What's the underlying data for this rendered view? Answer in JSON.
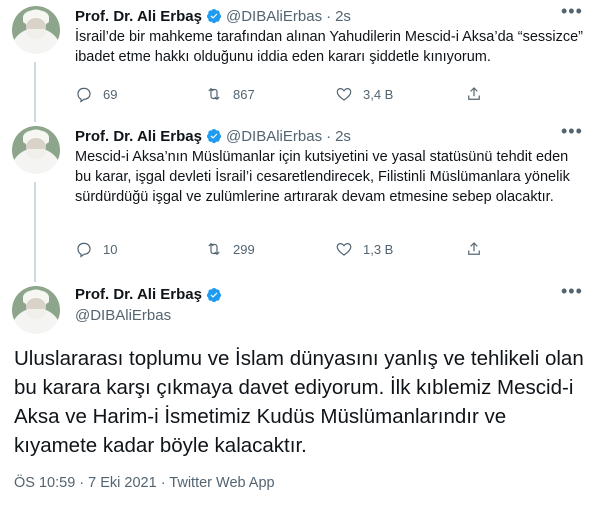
{
  "tweets": [
    {
      "name": "Prof. Dr. Ali Erbaş",
      "handle": "@DIBAliErbas",
      "separator": "·",
      "time": "2s",
      "text": "İsrail’de bir mahkeme tarafından alınan Yahudilerin Mescid-i Aksa’da “sessizce” ibadet etme hakkı olduğunu iddia eden kararı şiddetle kınıyorum.",
      "replies": "69",
      "retweets": "867",
      "likes": "3,4 B"
    },
    {
      "name": "Prof. Dr. Ali Erbaş",
      "handle": "@DIBAliErbas",
      "separator": "·",
      "time": "2s",
      "text": "Mescid-i Aksa’nın Müslümanlar için kutsiyetini ve yasal statüsünü tehdit eden bu karar, işgal devleti İsrail’i cesaretlendirecek, Filistinli Müslümanlara yönelik sürdürdüğü işgal ve zulümlerine artırarak devam etmesine sebep olacaktır.",
      "replies": "10",
      "retweets": "299",
      "likes": "1,3 B"
    }
  ],
  "main": {
    "name": "Prof. Dr. Ali Erbaş",
    "handle": "@DIBAliErbas",
    "text": "Uluslararası toplumu ve İslam dünyasını yanlış ve tehlikeli olan bu karara karşı çıkmaya davet ediyorum. İlk kıblemiz Mescid-i Aksa ve Harim-i İsmetimiz Kudüs Müslümanlarındır ve kıyamete kadar böyle kalacaktır.",
    "meta": "ÖS 10:59 · 7 Eki 2021 · Twitter Web App"
  },
  "colors": {
    "verified": "#1d9bf0",
    "muted": "#536471",
    "text": "#0f1419"
  },
  "icons": [
    "verified-badge-icon",
    "more-icon",
    "reply-icon",
    "retweet-icon",
    "like-icon",
    "share-icon"
  ]
}
